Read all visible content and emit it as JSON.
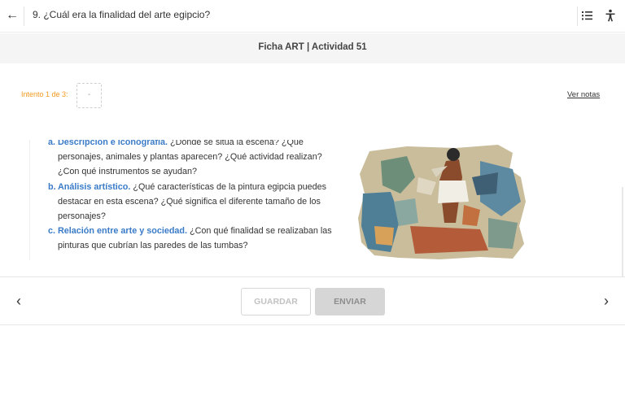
{
  "header": {
    "back_icon": "arrow-left-icon",
    "title": "9. ¿Cuál era la finalidad del arte egipcio?",
    "list_icon": "list-icon",
    "accessibility_icon": "accessibility-icon"
  },
  "subheader": {
    "title": "Ficha ART | Actividad 51"
  },
  "attempt": {
    "label": "Intento 1 de 3:",
    "value": "-"
  },
  "notes_link": "Ver notas",
  "items": [
    {
      "marker": "a.",
      "head": "Descripción e iconografía.",
      "text": " ¿Dónde se sitúa la escena? ¿Qué personajes, animales y plantas aparecen? ¿Qué actividad realizan? ¿Con qué instrumentos se ayudan?"
    },
    {
      "marker": "b.",
      "head": "Análisis artístico.",
      "text": " ¿Qué características de la pintura egipcia puedes destacar en esta escena? ¿Qué significa el diferente tamaño de los personajes?"
    },
    {
      "marker": "c.",
      "head": "Relación entre arte y sociedad.",
      "text": " ¿Con qué finalidad se realizaban las pinturas que cubrían las paredes de las tumbas?"
    }
  ],
  "footer": {
    "prev_icon": "chevron-left-icon",
    "next_icon": "chevron-right-icon",
    "save_label": "GUARDAR",
    "send_label": "ENVIAR"
  },
  "colors": {
    "accent": "#3a7bc8",
    "attempt": "#f39a1f"
  }
}
